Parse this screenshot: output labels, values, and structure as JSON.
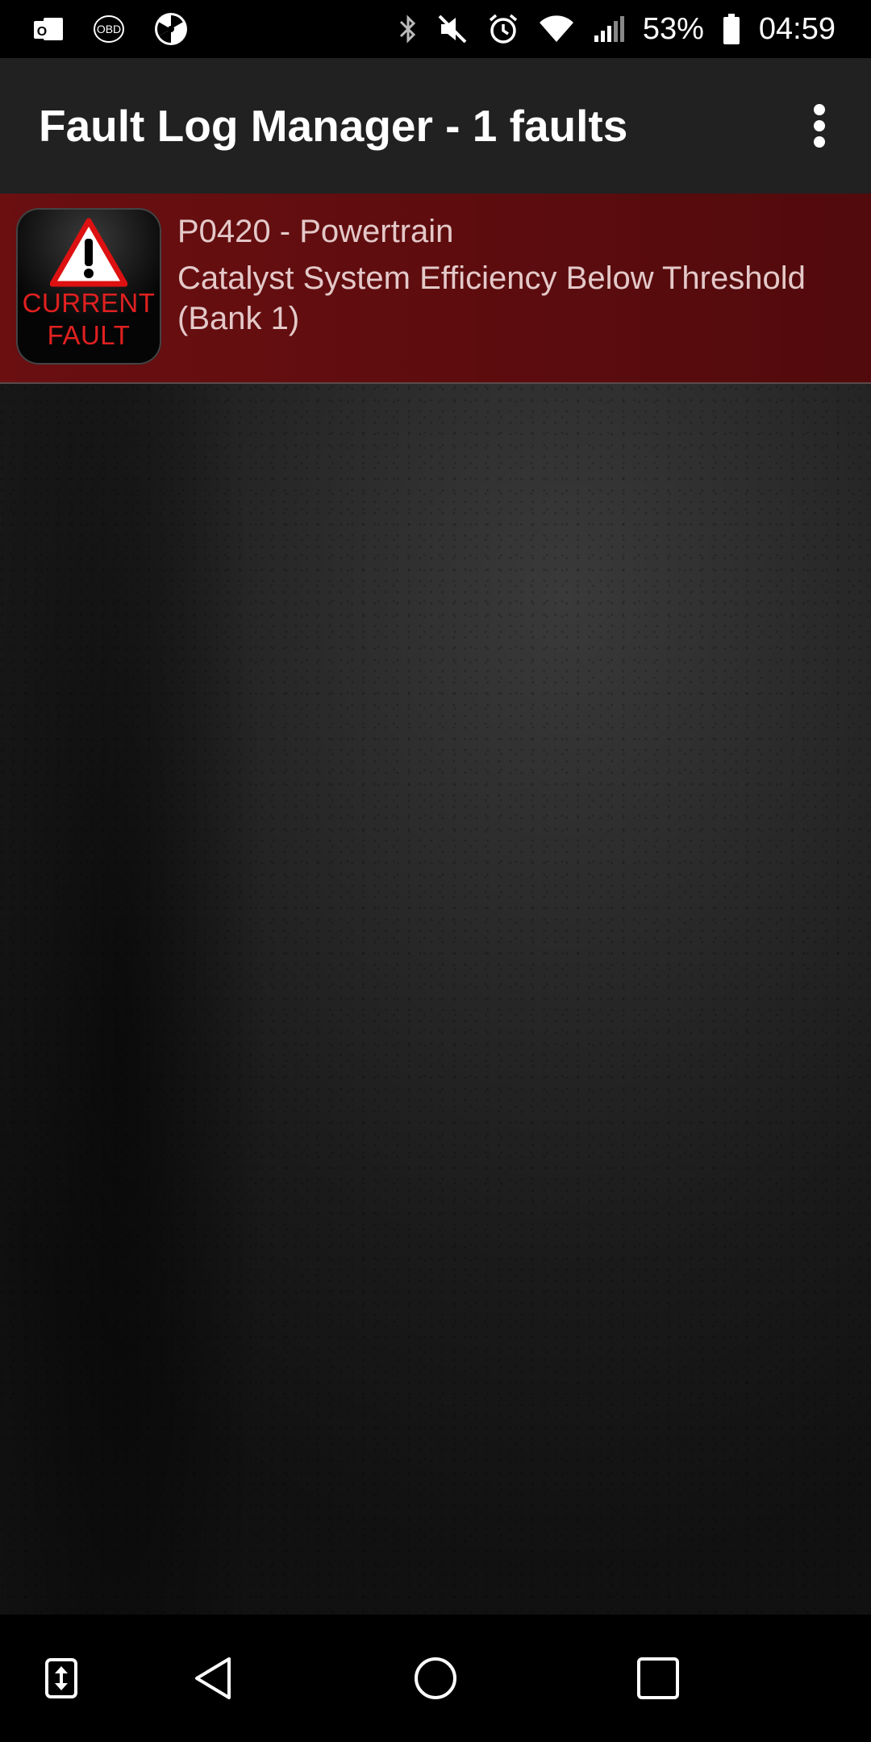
{
  "status_bar": {
    "left_icons": [
      "outlook-icon",
      "obd-icon",
      "radiation-icon"
    ],
    "right_icons": [
      "bluetooth-icon",
      "mute-icon",
      "alarm-icon",
      "wifi-icon",
      "signal-icon"
    ],
    "battery_percent": "53%",
    "time": "04:59"
  },
  "app_bar": {
    "title": "Fault Log Manager - 1 faults",
    "overflow_icon": "more-vert-icon"
  },
  "faults": [
    {
      "badge_line1": "CURRENT",
      "badge_line2": "FAULT",
      "code": "P0420 - Powertrain",
      "description": "Catalyst System Efficiency Below Threshold (Bank 1)"
    }
  ],
  "nav_bar": {
    "icons": [
      "screen-swap-icon",
      "back-icon",
      "home-icon",
      "recents-icon"
    ]
  },
  "colors": {
    "fault_row": "#6b0f11",
    "badge_text": "#e02020",
    "app_bar": "#212121"
  }
}
